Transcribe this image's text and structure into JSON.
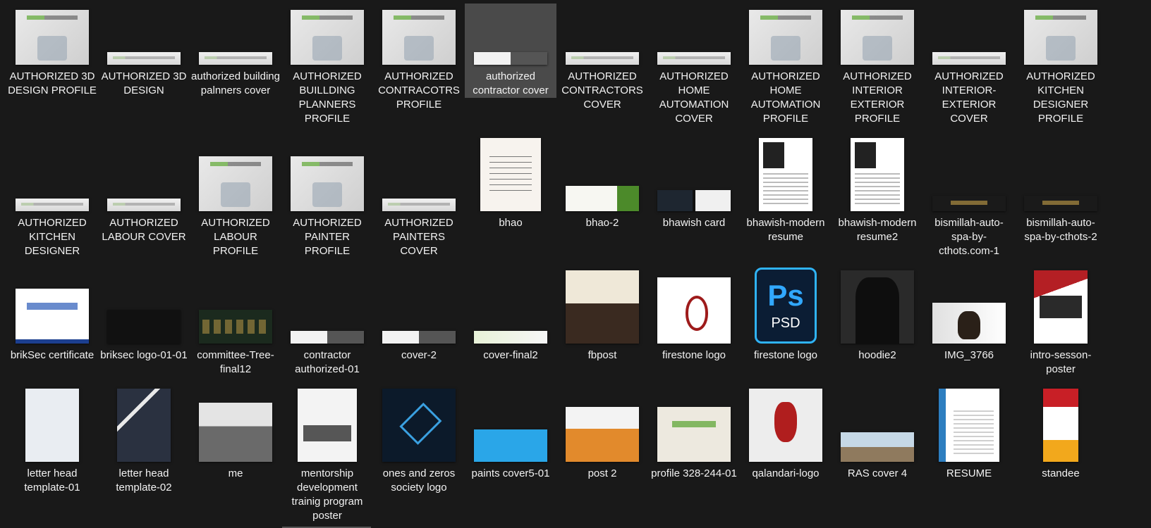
{
  "files": [
    {
      "label": "AUTHORIZED 3D DESIGN PROFILE",
      "thumb": "profile"
    },
    {
      "label": "AUTHORIZED 3D DESIGN",
      "thumb": "cover"
    },
    {
      "label": "authorized building palnners cover",
      "thumb": "cover"
    },
    {
      "label": "AUTHORIZED BUILLDING PLANNERS PROFILE",
      "thumb": "profile"
    },
    {
      "label": "AUTHORIZED CONTRACOTRS PROFILE",
      "thumb": "profile"
    },
    {
      "label": "authorized contractor cover",
      "thumb": "city2",
      "selected": true
    },
    {
      "label": "AUTHORIZED CONTRACTORS COVER",
      "thumb": "cover"
    },
    {
      "label": "AUTHORIZED HOME AUTOMATION COVER",
      "thumb": "cover"
    },
    {
      "label": "AUTHORIZED HOME AUTOMATION PROFILE",
      "thumb": "profile"
    },
    {
      "label": "AUTHORIZED INTERIOR EXTERIOR PROFILE",
      "thumb": "profile"
    },
    {
      "label": "AUTHORIZED INTERIOR-EXTERIOR COVER",
      "thumb": "cover"
    },
    {
      "label": "AUTHORIZED KITCHEN DESIGNER PROFILE",
      "thumb": "profile"
    },
    {
      "label": "AUTHORIZED KITCHEN DESIGNER",
      "thumb": "cover"
    },
    {
      "label": "AUTHORIZED LABOUR COVER",
      "thumb": "cover"
    },
    {
      "label": "AUTHORIZED LABOUR PROFILE",
      "thumb": "profile"
    },
    {
      "label": "AUTHORIZED PAINTER PROFILE",
      "thumb": "profile"
    },
    {
      "label": "AUTHORIZED PAINTERS COVER",
      "thumb": "cover"
    },
    {
      "label": "bhao",
      "thumb": "bhao"
    },
    {
      "label": "bhao-2",
      "thumb": "bhao2"
    },
    {
      "label": "bhawish card",
      "thumb": "card"
    },
    {
      "label": "bhawish-modern resume",
      "thumb": "resume"
    },
    {
      "label": "bhawish-modern resume2",
      "thumb": "resume"
    },
    {
      "label": "bismillah-auto-spa-by-cthots.com-1",
      "thumb": "bism"
    },
    {
      "label": "bismillah-auto-spa-by-cthots-2",
      "thumb": "bism"
    },
    {
      "label": "brikSec certificate",
      "thumb": "cert"
    },
    {
      "label": "briksec logo-01-01",
      "thumb": "dark"
    },
    {
      "label": "committee-Tree-final12",
      "thumb": "tree"
    },
    {
      "label": "contractor authorized-01",
      "thumb": "city2"
    },
    {
      "label": "cover-2",
      "thumb": "city2"
    },
    {
      "label": "cover-final2",
      "thumb": "green"
    },
    {
      "label": "fbpost",
      "thumb": "fb"
    },
    {
      "label": "firestone logo",
      "thumb": "firestone"
    },
    {
      "label": "firestone logo",
      "thumb": "psd",
      "psd_icon": {
        "main": "Ps",
        "sub": "PSD"
      }
    },
    {
      "label": "hoodie2",
      "thumb": "hoodie"
    },
    {
      "label": "IMG_3766",
      "thumb": "img"
    },
    {
      "label": "intro-sesson-poster",
      "thumb": "poster"
    },
    {
      "label": "letter head template-01",
      "thumb": "letter"
    },
    {
      "label": "letter head template-02",
      "thumb": "letter2"
    },
    {
      "label": "me",
      "thumb": "city"
    },
    {
      "label": "mentorship development trainig program poster",
      "thumb": "mentor"
    },
    {
      "label": "ones and zeros society logo",
      "thumb": "ones"
    },
    {
      "label": "paints cover5-01",
      "thumb": "paints"
    },
    {
      "label": "post 2",
      "thumb": "post"
    },
    {
      "label": "profile 328-244-01",
      "thumb": "arch"
    },
    {
      "label": "qalandari-logo",
      "thumb": "qal"
    },
    {
      "label": "RAS cover 4",
      "thumb": "ras"
    },
    {
      "label": "RESUME",
      "thumb": "resume2"
    },
    {
      "label": "standee",
      "thumb": "stand"
    }
  ]
}
